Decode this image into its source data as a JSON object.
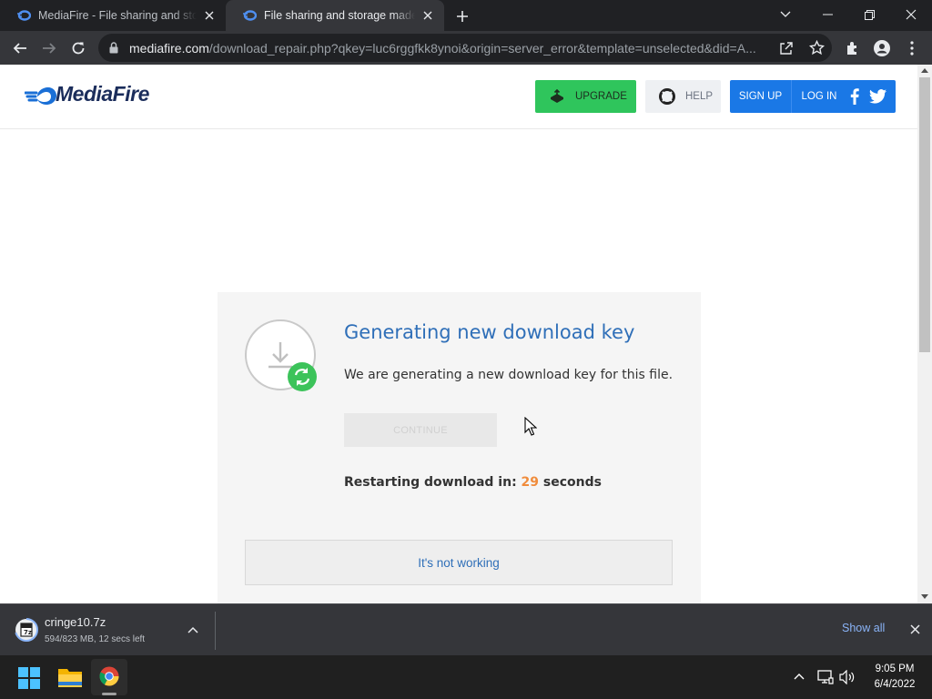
{
  "browser": {
    "tabs": [
      {
        "label": "MediaFire - File sharing and storage made simple"
      },
      {
        "label": "File sharing and storage made simple"
      }
    ],
    "url_host": "mediafire.com",
    "url_path": "/download_repair.php?qkey=luc6rggfkk8ynoi&origin=server_error&template=unselected&did=A..."
  },
  "site": {
    "logo_text": "MediaFire",
    "nav": {
      "upgrade_label": "UPGRADE",
      "help_label": "HELP",
      "signup_label": "SIGN UP",
      "login_label": "LOG IN"
    },
    "card": {
      "title": "Generating new download key",
      "description": "We are generating a new download key for this file.",
      "continue_label": "CONTINUE",
      "restart_prefix": "Restarting download in: ",
      "restart_count": "29",
      "restart_suffix": " seconds",
      "not_working_label": "It's not working"
    }
  },
  "download_shelf": {
    "file_name": "cringe10.7z",
    "status": "594/823 MB, 12 secs left",
    "show_all_label": "Show all"
  },
  "taskbar": {
    "time": "9:05 PM",
    "date": "6/4/2022"
  },
  "colors": {
    "upgrade_green": "#2fc55c",
    "brand_blue": "#1a78e6",
    "title_blue": "#2f6fb8",
    "countdown_orange": "#f08c3c"
  }
}
